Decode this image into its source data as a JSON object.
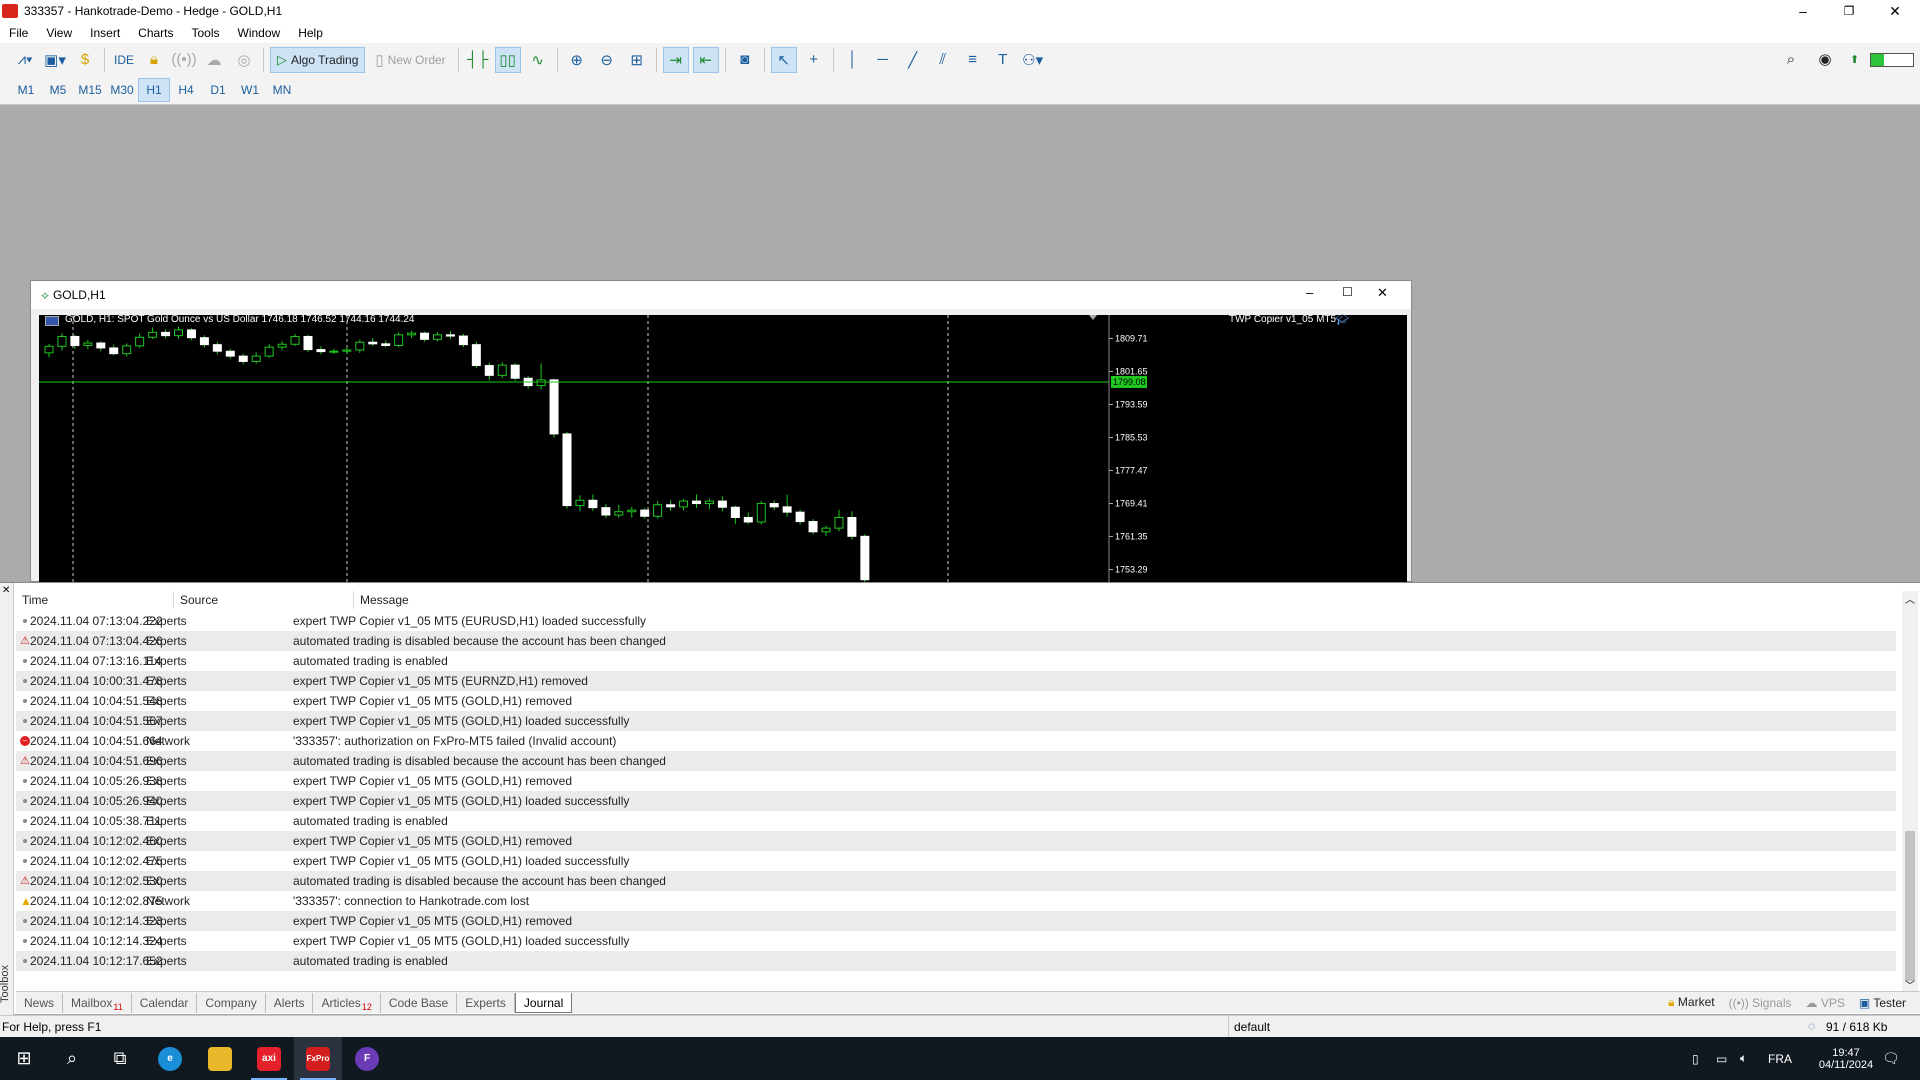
{
  "window": {
    "title": "333357 - Hankotrade-Demo - Hedge - GOLD,H1",
    "minimize": "–",
    "restore": "❐",
    "close": "✕"
  },
  "menu": [
    "File",
    "View",
    "Insert",
    "Charts",
    "Tools",
    "Window",
    "Help"
  ],
  "toolbar": {
    "ide_label": "IDE",
    "algo_trading_label": "Algo Trading",
    "new_order_label": "New Order"
  },
  "timeframes": [
    "M1",
    "M5",
    "M15",
    "M30",
    "H1",
    "H4",
    "D1",
    "W1",
    "MN"
  ],
  "active_timeframe": "H1",
  "chart_window": {
    "title": "GOLD,H1",
    "header_text": "GOLD, H1:  SPOT Gold Ounce vs US Dollar  1746.18 1746.52 1744.16 1744.24",
    "ea_label": "TWP Copier v1_05 MT5",
    "price_labels": [
      "1809.71",
      "1801.65",
      "1793.59",
      "1785.53",
      "1777.47",
      "1769.41",
      "1761.35",
      "1753.29"
    ],
    "current_price": "1799.08"
  },
  "chart_data": {
    "type": "candlestick",
    "symbol": "GOLD",
    "timeframe": "H1",
    "y_range": [
      1750,
      1813
    ],
    "current_price": 1799.08,
    "candles": [
      [
        1806.2,
        1808.4,
        1805.1,
        1807.8
      ],
      [
        1807.8,
        1811.0,
        1806.8,
        1810.2
      ],
      [
        1810.2,
        1810.6,
        1807.2,
        1808.0
      ],
      [
        1808.0,
        1809.4,
        1807.1,
        1808.6
      ],
      [
        1808.6,
        1809.0,
        1806.6,
        1807.4
      ],
      [
        1807.4,
        1808.2,
        1805.6,
        1806.0
      ],
      [
        1806.0,
        1808.5,
        1805.3,
        1807.9
      ],
      [
        1807.9,
        1810.9,
        1807.4,
        1810.0
      ],
      [
        1810.0,
        1812.4,
        1809.6,
        1811.2
      ],
      [
        1811.2,
        1812.0,
        1809.8,
        1810.4
      ],
      [
        1810.4,
        1812.6,
        1809.7,
        1811.8
      ],
      [
        1811.8,
        1812.2,
        1809.3,
        1809.9
      ],
      [
        1809.9,
        1810.5,
        1807.5,
        1808.2
      ],
      [
        1808.2,
        1808.8,
        1805.8,
        1806.6
      ],
      [
        1806.6,
        1807.2,
        1804.8,
        1805.4
      ],
      [
        1805.4,
        1806.0,
        1803.5,
        1804.1
      ],
      [
        1804.1,
        1806.3,
        1803.6,
        1805.4
      ],
      [
        1805.4,
        1808.3,
        1805.0,
        1807.6
      ],
      [
        1807.6,
        1809.0,
        1806.8,
        1808.3
      ],
      [
        1808.3,
        1810.8,
        1807.9,
        1810.2
      ],
      [
        1810.2,
        1810.6,
        1806.4,
        1807.0
      ],
      [
        1807.0,
        1807.8,
        1805.8,
        1806.5
      ],
      [
        1806.5,
        1807.2,
        1805.9,
        1806.6
      ],
      [
        1806.6,
        1807.6,
        1805.9,
        1806.9
      ],
      [
        1806.9,
        1809.4,
        1806.2,
        1808.8
      ],
      [
        1808.8,
        1809.8,
        1807.9,
        1808.4
      ],
      [
        1808.4,
        1809.2,
        1807.5,
        1808.0
      ],
      [
        1808.0,
        1811.2,
        1807.6,
        1810.6
      ],
      [
        1810.6,
        1811.6,
        1809.8,
        1811.0
      ],
      [
        1811.0,
        1811.4,
        1808.9,
        1809.5
      ],
      [
        1809.5,
        1811.2,
        1809.0,
        1810.6
      ],
      [
        1810.6,
        1811.5,
        1809.5,
        1810.3
      ],
      [
        1810.3,
        1810.8,
        1807.6,
        1808.2
      ],
      [
        1808.2,
        1808.9,
        1802.5,
        1803.1
      ],
      [
        1803.1,
        1803.8,
        1799.5,
        1800.7
      ],
      [
        1800.7,
        1803.9,
        1800.1,
        1803.2
      ],
      [
        1803.2,
        1803.7,
        1799.4,
        1800.0
      ],
      [
        1800.0,
        1800.5,
        1797.5,
        1798.2
      ],
      [
        1798.2,
        1803.6,
        1797.3,
        1799.6
      ],
      [
        1799.6,
        1799.9,
        1785.5,
        1786.4
      ],
      [
        1786.4,
        1786.9,
        1768.2,
        1768.9
      ],
      [
        1768.9,
        1771.4,
        1767.5,
        1770.2
      ],
      [
        1770.2,
        1771.6,
        1767.6,
        1768.4
      ],
      [
        1768.4,
        1769.3,
        1765.9,
        1766.6
      ],
      [
        1766.6,
        1769.1,
        1765.9,
        1767.4
      ],
      [
        1767.4,
        1768.6,
        1766.0,
        1767.8
      ],
      [
        1767.8,
        1768.3,
        1765.7,
        1766.3
      ],
      [
        1766.3,
        1770.0,
        1765.7,
        1769.1
      ],
      [
        1769.1,
        1770.2,
        1767.6,
        1768.6
      ],
      [
        1768.6,
        1770.5,
        1767.7,
        1770.0
      ],
      [
        1770.0,
        1771.6,
        1768.3,
        1769.4
      ],
      [
        1769.4,
        1770.6,
        1768.0,
        1770.0
      ],
      [
        1770.0,
        1771.2,
        1767.5,
        1768.5
      ],
      [
        1768.5,
        1768.9,
        1764.4,
        1766.0
      ],
      [
        1766.0,
        1767.2,
        1764.4,
        1764.9
      ],
      [
        1764.9,
        1770.1,
        1764.3,
        1769.4
      ],
      [
        1769.4,
        1770.2,
        1767.8,
        1768.6
      ],
      [
        1768.6,
        1771.6,
        1766.2,
        1767.3
      ],
      [
        1767.3,
        1767.9,
        1764.3,
        1765.0
      ],
      [
        1765.0,
        1765.6,
        1761.9,
        1762.5
      ],
      [
        1762.5,
        1764.0,
        1761.5,
        1763.4
      ],
      [
        1763.4,
        1767.9,
        1762.6,
        1766.0
      ],
      [
        1766.0,
        1767.5,
        1760.6,
        1761.4
      ],
      [
        1761.4,
        1761.9,
        1750.0,
        1750.8
      ]
    ]
  },
  "journal": {
    "headers": [
      "Time",
      "Source",
      "Message"
    ],
    "rows": [
      {
        "sev": "info",
        "time": "2024.11.04 07:13:04.222",
        "source": "Experts",
        "message": "expert TWP Copier v1_05 MT5 (EURUSD,H1) loaded successfully"
      },
      {
        "sev": "warn",
        "time": "2024.11.04 07:13:04.426",
        "source": "Experts",
        "message": "automated trading is disabled because the account has been changed"
      },
      {
        "sev": "info",
        "time": "2024.11.04 07:13:16.114",
        "source": "Experts",
        "message": "automated trading is enabled"
      },
      {
        "sev": "info",
        "time": "2024.11.04 10:00:31.478",
        "source": "Experts",
        "message": "expert TWP Copier v1_05 MT5 (EURNZD,H1) removed"
      },
      {
        "sev": "info",
        "time": "2024.11.04 10:04:51.548",
        "source": "Experts",
        "message": "expert TWP Copier v1_05 MT5 (GOLD,H1) removed"
      },
      {
        "sev": "info",
        "time": "2024.11.04 10:04:51.567",
        "source": "Experts",
        "message": "expert TWP Copier v1_05 MT5 (GOLD,H1) loaded successfully"
      },
      {
        "sev": "err",
        "time": "2024.11.04 10:04:51.664",
        "source": "Network",
        "message": "'333357': authorization on FxPro-MT5 failed (Invalid account)"
      },
      {
        "sev": "warn",
        "time": "2024.11.04 10:04:51.696",
        "source": "Experts",
        "message": "automated trading is disabled because the account has been changed"
      },
      {
        "sev": "info",
        "time": "2024.11.04 10:05:26.938",
        "source": "Experts",
        "message": "expert TWP Copier v1_05 MT5 (GOLD,H1) removed"
      },
      {
        "sev": "info",
        "time": "2024.11.04 10:05:26.940",
        "source": "Experts",
        "message": "expert TWP Copier v1_05 MT5 (GOLD,H1) loaded successfully"
      },
      {
        "sev": "info",
        "time": "2024.11.04 10:05:38.711",
        "source": "Experts",
        "message": "automated trading is enabled"
      },
      {
        "sev": "info",
        "time": "2024.11.04 10:12:02.460",
        "source": "Experts",
        "message": "expert TWP Copier v1_05 MT5 (GOLD,H1) removed"
      },
      {
        "sev": "info",
        "time": "2024.11.04 10:12:02.475",
        "source": "Experts",
        "message": "expert TWP Copier v1_05 MT5 (GOLD,H1) loaded successfully"
      },
      {
        "sev": "warn",
        "time": "2024.11.04 10:12:02.530",
        "source": "Experts",
        "message": "automated trading is disabled because the account has been changed"
      },
      {
        "sev": "net",
        "time": "2024.11.04 10:12:02.875",
        "source": "Network",
        "message": "'333357': connection to Hankotrade.com lost"
      },
      {
        "sev": "info",
        "time": "2024.11.04 10:12:14.323",
        "source": "Experts",
        "message": "expert TWP Copier v1_05 MT5 (GOLD,H1) removed"
      },
      {
        "sev": "info",
        "time": "2024.11.04 10:12:14.324",
        "source": "Experts",
        "message": "expert TWP Copier v1_05 MT5 (GOLD,H1) loaded successfully"
      },
      {
        "sev": "info",
        "time": "2024.11.04 10:12:17.652",
        "source": "Experts",
        "message": "automated trading is enabled"
      }
    ]
  },
  "toolbox": {
    "side_label": "Toolbox",
    "tabs": [
      {
        "label": "News",
        "badge": ""
      },
      {
        "label": "Mailbox",
        "badge": "11"
      },
      {
        "label": "Calendar",
        "badge": ""
      },
      {
        "label": "Company",
        "badge": ""
      },
      {
        "label": "Alerts",
        "badge": ""
      },
      {
        "label": "Articles",
        "badge": "12"
      },
      {
        "label": "Code Base",
        "badge": ""
      },
      {
        "label": "Experts",
        "badge": ""
      },
      {
        "label": "Journal",
        "badge": ""
      }
    ],
    "active_tab": "Journal",
    "right_tabs": {
      "market": "Market",
      "signals": "Signals",
      "vps": "VPS",
      "tester": "Tester"
    }
  },
  "statusbar": {
    "help": "For Help, press F1",
    "profile": "default",
    "traffic": "91 / 618 Kb"
  },
  "taskbar": {
    "app_labels": {
      "axi": "axi",
      "fxpro": "FxPro"
    },
    "language": "FRA",
    "time": "19:47",
    "date": "04/11/2024"
  }
}
